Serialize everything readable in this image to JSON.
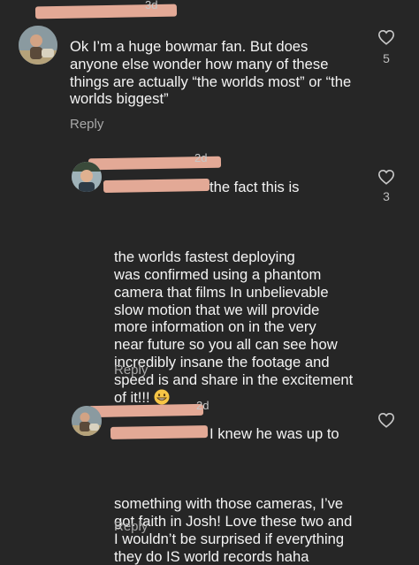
{
  "comments": [
    {
      "meta_fragment": "3d",
      "text": "Ok I’m a huge bowmar fan. But does\nanyone else wonder how many of these\nthings are actually “the worlds most” or “the\nworlds biggest”",
      "reply_label": "Reply",
      "like_count": "5"
    },
    {
      "meta_fragment": "2d",
      "text_start": "the fact this is",
      "text_rest": "the worlds fastest deploying\nwas confirmed using a phantom\ncamera that films In unbelievable\nslow motion that we will provide\nmore information on in the very\nnear future so you all can see how\nincredibly insane the footage and\nspeed is and share in the excitement\nof it!!! ",
      "emoji": "grinning-face-emoji",
      "reply_label": "Reply",
      "like_count": "3"
    },
    {
      "meta_fragment": "2d",
      "text_start": "I knew he was up to",
      "text_rest": "something with those cameras, I’ve\ngot faith in Josh! Love these two and\nI wouldn’t be surprised if everything\nthey do IS world records haha",
      "reply_label": "Reply"
    }
  ],
  "colors": {
    "background": "#262626",
    "text": "#f4f4f4",
    "secondary_text": "#a8a8a8",
    "redaction": "#e3a996"
  },
  "icons": {
    "like": "heart-outline-icon"
  }
}
